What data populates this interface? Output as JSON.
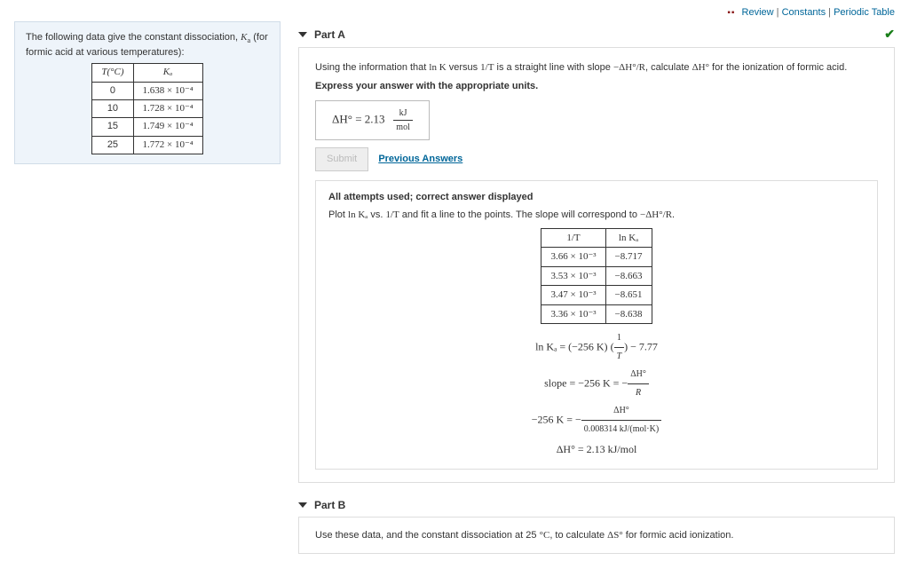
{
  "toplinks": {
    "review": "Review",
    "constants": "Constants",
    "ptable": "Periodic Table"
  },
  "left": {
    "intro_a": "The following data give the constant dissociation, ",
    "intro_sym": "K",
    "intro_sub": "a",
    "intro_b": " (for formic acid at various temperatures):",
    "headers": {
      "t": "T(°C)",
      "k": "Kₐ"
    },
    "rows": [
      {
        "t": "0",
        "k": "1.638 × 10⁻⁴"
      },
      {
        "t": "10",
        "k": "1.728 × 10⁻⁴"
      },
      {
        "t": "15",
        "k": "1.749 × 10⁻⁴"
      },
      {
        "t": "25",
        "k": "1.772 × 10⁻⁴"
      }
    ]
  },
  "partA": {
    "title": "Part A",
    "prompt_a": "Using the information that ",
    "prompt_b": " versus ",
    "prompt_c": " is a straight line with slope ",
    "prompt_d": ", calculate ",
    "prompt_e": " for the ionization of formic acid.",
    "lnK": "ln K",
    "oneOverT": "1/T",
    "slope_expr": "−ΔH°/R",
    "dH": "ΔH°",
    "express": "Express your answer with the appropriate units.",
    "answer_lhs": "ΔH°",
    "answer_eq": " = ",
    "answer_val": "2.13",
    "answer_unit_num": "kJ",
    "answer_unit_den": "mol",
    "submit": "Submit",
    "prev": "Previous Answers",
    "feedback_title": "All attempts used; correct answer displayed",
    "feedback_text_a": "Plot ",
    "feedback_lnKa": "ln Kₐ",
    "feedback_text_b": " vs. ",
    "feedback_text_c": " and fit a line to the points. The slope will correspond to ",
    "feedback_text_d": ".",
    "sol_headers": {
      "x": "1/T",
      "y": "ln Kₐ"
    },
    "sol_rows": [
      {
        "x": "3.66 × 10⁻³",
        "y": "−8.717"
      },
      {
        "x": "3.53 × 10⁻³",
        "y": "−8.663"
      },
      {
        "x": "3.47 × 10⁻³",
        "y": "−8.651"
      },
      {
        "x": "3.36 × 10⁻³",
        "y": "−8.638"
      }
    ],
    "eq1_l": "ln Kₐ = (−256 K) ",
    "eq1_frac_n": "1",
    "eq1_frac_d": "T",
    "eq1_r": " − 7.77",
    "eq2_l": "slope = −256 K = −",
    "eq2_frac_n": "ΔH°",
    "eq2_frac_d": "R",
    "eq3_l": "−256 K = −",
    "eq3_frac_n": "ΔH°",
    "eq3_frac_d": "0.008314 kJ/(mol·K)",
    "eq4": "ΔH° = 2.13 kJ/mol"
  },
  "partB": {
    "title": "Part B",
    "prompt_a": "Use these data, and the constant dissociation at 25 ",
    "deg": "°C",
    "prompt_b": ", to calculate ",
    "dS": "ΔS°",
    "prompt_c": " for formic acid ionization."
  }
}
